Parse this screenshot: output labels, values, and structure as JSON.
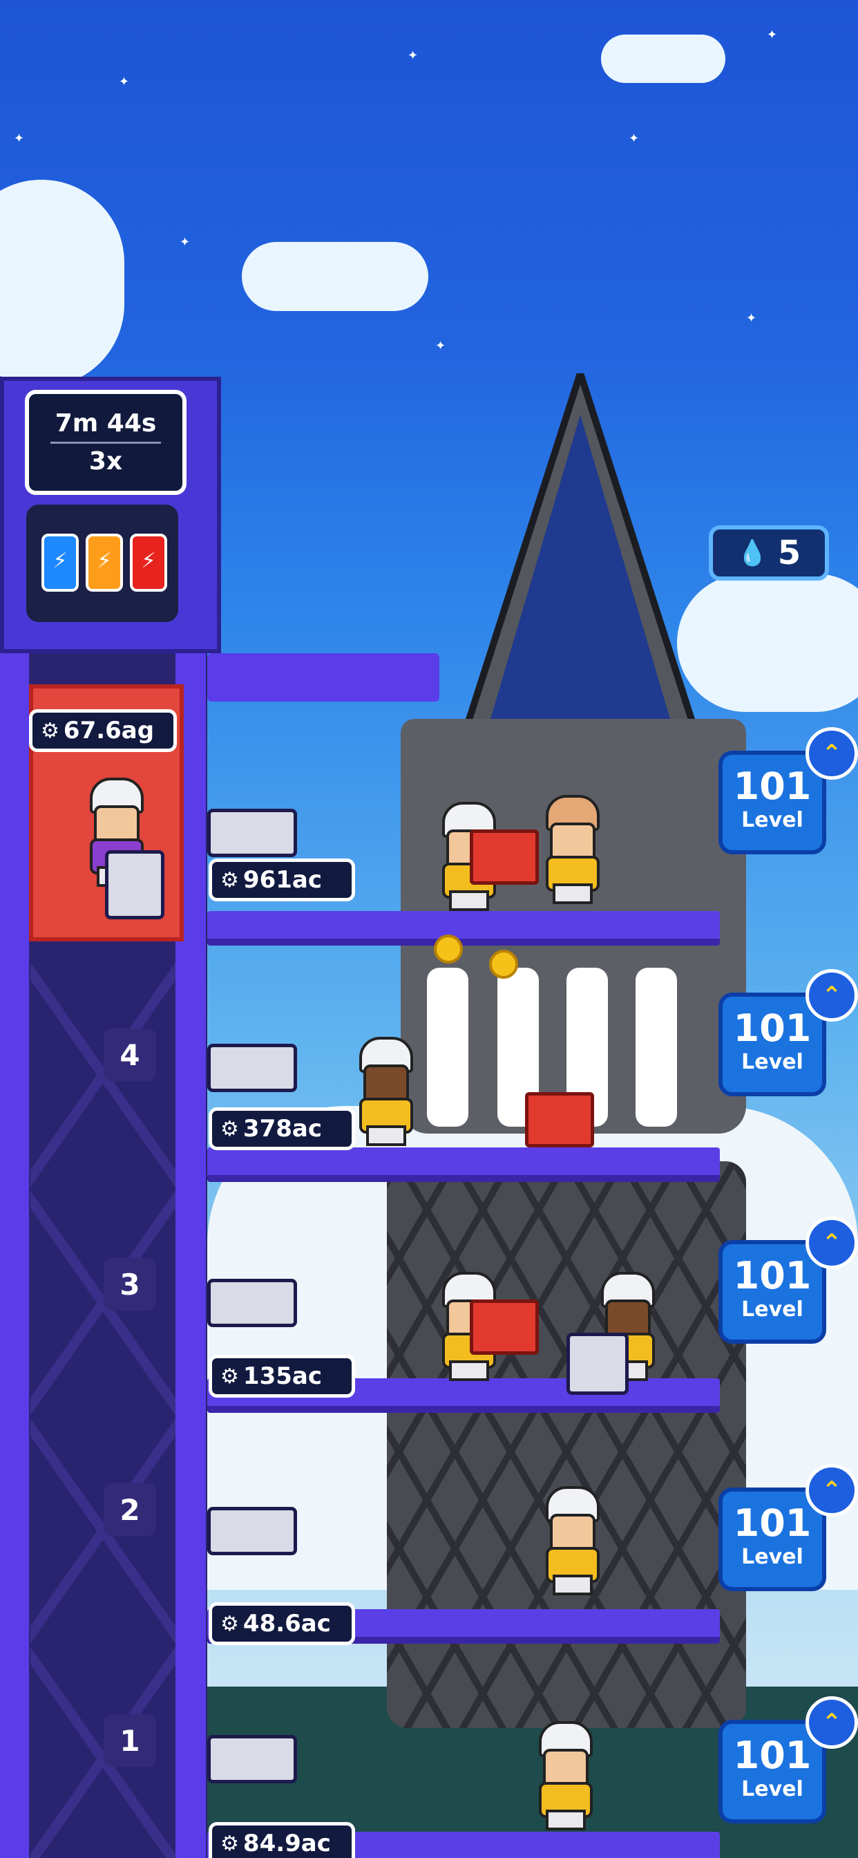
{
  "timer": {
    "time": "7m 44s",
    "multiplier": "3x"
  },
  "elevator": {
    "label": "67.6ag"
  },
  "resources": {
    "drops": "5"
  },
  "floors": [
    {
      "number": "",
      "storage": "961ac",
      "level": "101",
      "level_label": "Level"
    },
    {
      "number": "4",
      "storage": "378ac",
      "level": "101",
      "level_label": "Level"
    },
    {
      "number": "3",
      "storage": "135ac",
      "level": "101",
      "level_label": "Level"
    },
    {
      "number": "2",
      "storage": "48.6ac",
      "level": "101",
      "level_label": "Level"
    },
    {
      "number": "1",
      "storage": "84.9ac",
      "level": "101",
      "level_label": "Level"
    }
  ],
  "icons": {
    "gear": "gear-icon",
    "drop": "water-drop-icon",
    "upgrade": "double-chevron-up-icon",
    "potion_colors": [
      "#1e88ff",
      "#ff9d1a",
      "#e8231e"
    ]
  }
}
